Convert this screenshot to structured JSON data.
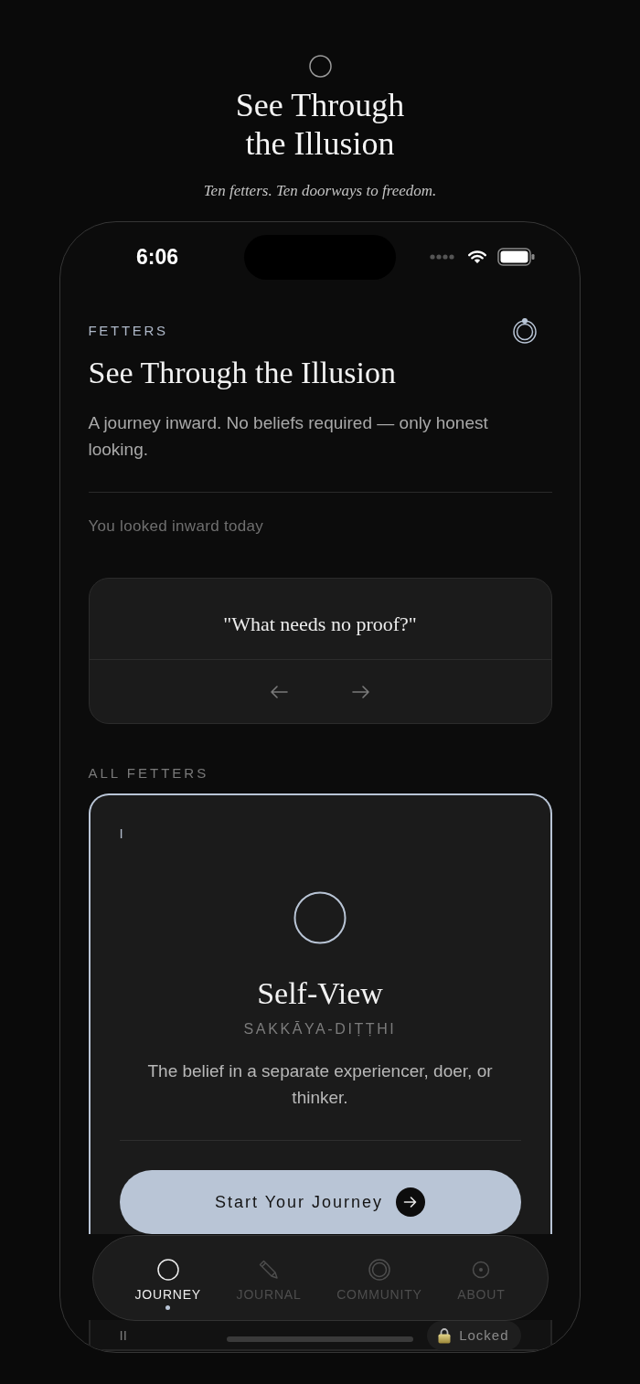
{
  "header": {
    "title": "See Through the Illusion",
    "subtitle": "Ten fetters. Ten doorways to freedom."
  },
  "status_bar": {
    "time": "6:06"
  },
  "intro": {
    "eyebrow": "FETTERS",
    "title": "See Through the Illusion",
    "description": "A journey inward. No beliefs required — only honest looking.",
    "streak_note": "You looked inward today"
  },
  "prompt_card": {
    "quote": "\"What needs no proof?\""
  },
  "fetters": {
    "label": "ALL FETTERS",
    "items": [
      {
        "numeral": "I",
        "name": "Self-View",
        "pali_name": "SAKKĀYA-DIṬṬHI",
        "description": "The belief in a separate experiencer, doer, or thinker.",
        "action": "Start Your Journey",
        "selected": true,
        "locked": false
      },
      {
        "numeral": "II",
        "status": "Locked",
        "selected": false,
        "locked": true
      }
    ]
  },
  "tab_bar": [
    {
      "label": "JOURNEY",
      "selected": true
    },
    {
      "label": "JOURNAL",
      "selected": false
    },
    {
      "label": "COMMUNITY",
      "selected": false
    },
    {
      "label": "ABOUT",
      "selected": false
    }
  ]
}
